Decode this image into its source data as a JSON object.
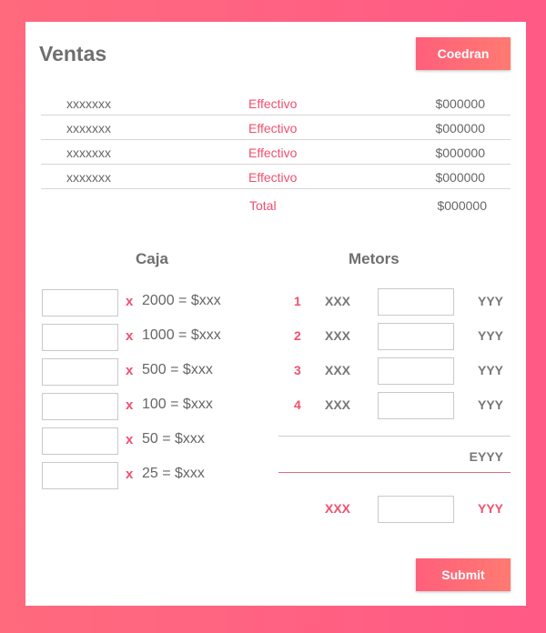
{
  "header": {
    "title": "Ventas",
    "button_label": "Coedran"
  },
  "sales": {
    "rows": [
      {
        "name": "xxxxxxx",
        "method": "Effectivo",
        "amount": "$000000"
      },
      {
        "name": "xxxxxxx",
        "method": "Effectivo",
        "amount": "$000000"
      },
      {
        "name": "xxxxxxx",
        "method": "Effectivo",
        "amount": "$000000"
      },
      {
        "name": "xxxxxxx",
        "method": "Effectivo",
        "amount": "$000000"
      }
    ],
    "total_label": "Total",
    "total_amount": "$000000"
  },
  "caja": {
    "title": "Caja",
    "rows": [
      {
        "x": "x",
        "expr": "2000  =  $xxx",
        "value": ""
      },
      {
        "x": "x",
        "expr": "1000  =  $xxx",
        "value": ""
      },
      {
        "x": "x",
        "expr": "500  =  $xxx",
        "value": ""
      },
      {
        "x": "x",
        "expr": "100  =  $xxx",
        "value": ""
      },
      {
        "x": "x",
        "expr": "50  =  $xxx",
        "value": ""
      },
      {
        "x": "x",
        "expr": "25  =  $xxx",
        "value": ""
      }
    ]
  },
  "metors": {
    "title": "Metors",
    "rows": [
      {
        "index": "1",
        "label": "XXX",
        "value": "",
        "result": "YYY"
      },
      {
        "index": "2",
        "label": "XXX",
        "value": "",
        "result": "YYY"
      },
      {
        "index": "3",
        "label": "XXX",
        "value": "",
        "result": "YYY"
      },
      {
        "index": "4",
        "label": "XXX",
        "value": "",
        "result": "YYY"
      }
    ],
    "subtotal": "EYYY",
    "final": {
      "label": "XXX",
      "value": "",
      "result": "YYY"
    }
  },
  "footer": {
    "submit_label": "Submit"
  },
  "colors": {
    "accent": "#f0506e",
    "background_start": "#ff6a7d",
    "background_end": "#ff5a86"
  }
}
